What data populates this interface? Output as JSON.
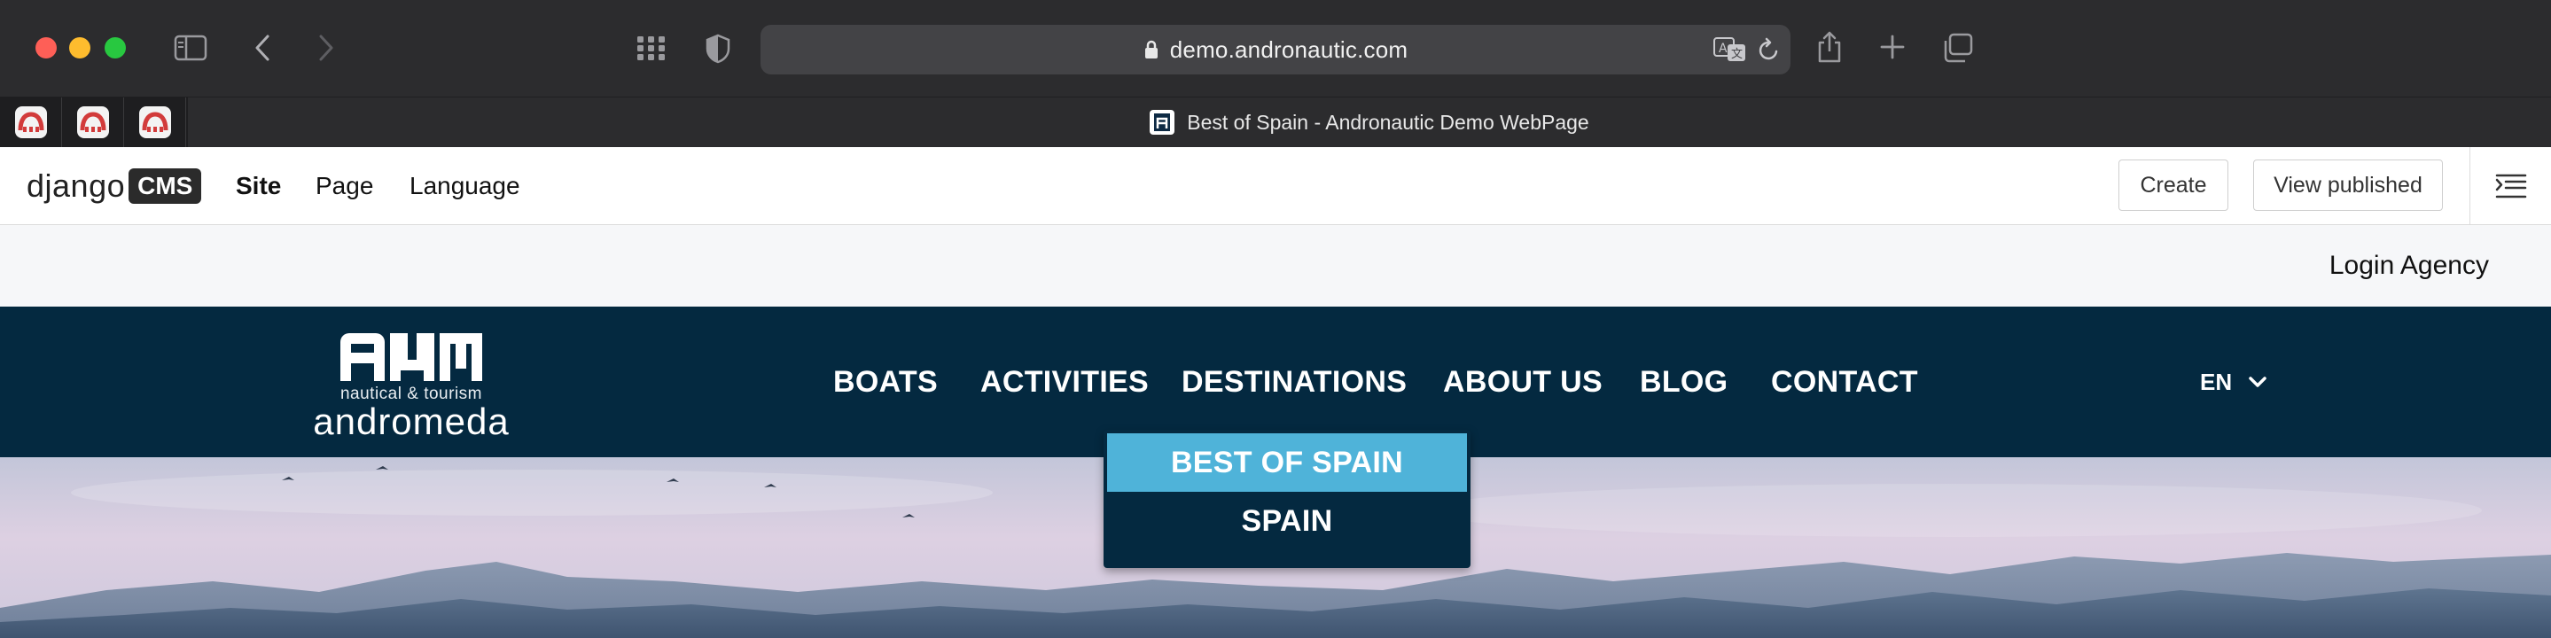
{
  "browser": {
    "url": "demo.andronautic.com",
    "tab_title": "Best of Spain - Andronautic Demo WebPage",
    "pinned_tabs": [
      "pinned-tab-1",
      "pinned-tab-2",
      "pinned-tab-3"
    ],
    "icons": {
      "close": "red-close-icon",
      "minimize": "yellow-minimize-icon",
      "zoom": "green-zoom-icon",
      "sidebar": "sidebar-icon",
      "back": "back-icon",
      "forward": "forward-icon",
      "grid": "grid-icon",
      "shield": "shield-icon",
      "lock": "lock-icon",
      "translate": "translate-icon",
      "reload": "reload-icon",
      "share": "share-icon",
      "new_tab": "plus-icon",
      "tabs": "tabs-overview-icon"
    }
  },
  "cms_toolbar": {
    "logo_django": "django",
    "logo_cms": "CMS",
    "menu_site": "Site",
    "menu_page": "Page",
    "menu_language": "Language",
    "create": "Create",
    "view_published": "View published"
  },
  "site": {
    "login": "Login Agency",
    "brand_subtitle": "nautical & tourism",
    "brand_name": "andromeda",
    "nav": {
      "boats": "BOATS",
      "activities": "ACTIVITIES",
      "destinations": "DESTINATIONS",
      "about_us": "ABOUT US",
      "blog": "BLOG",
      "contact": "CONTACT"
    },
    "language": "EN",
    "dropdown": {
      "item_active": "BEST OF SPAIN",
      "item_2": "SPAIN"
    }
  },
  "colors": {
    "nav_bg": "#042940",
    "dropdown_active": "#4fb3d9",
    "chrome_bg": "#2c2c2e"
  }
}
